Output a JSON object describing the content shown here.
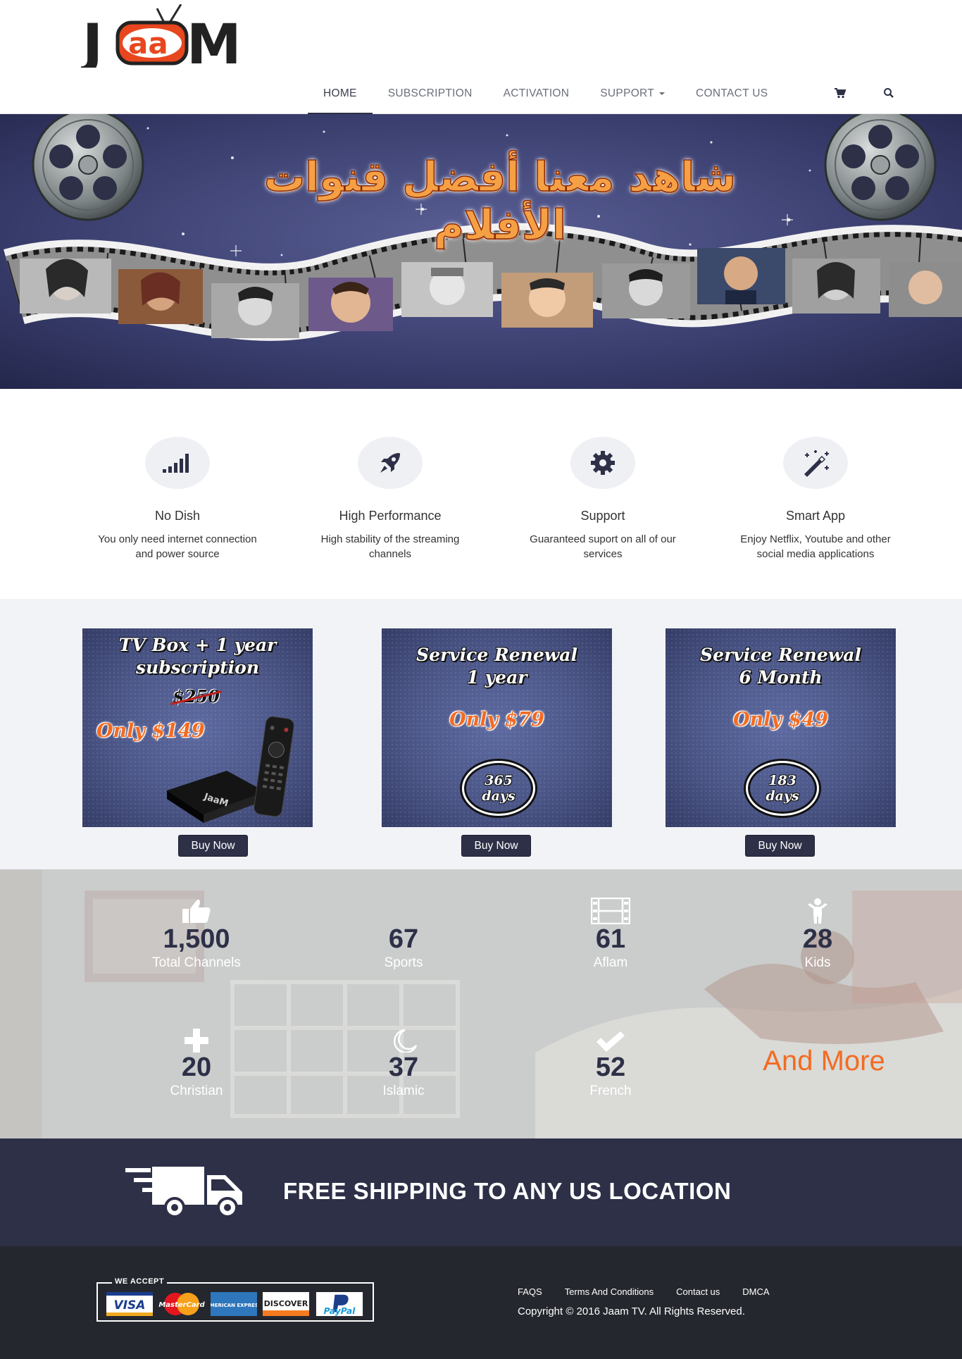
{
  "header": {
    "logo_text": "JaaM",
    "nav": [
      {
        "label": "HOME"
      },
      {
        "label": "SUBSCRIPTION"
      },
      {
        "label": "ACTIVATION"
      },
      {
        "label": "SUPPORT"
      },
      {
        "label": "CONTACT US"
      }
    ],
    "icons": [
      "cart-icon",
      "search-icon"
    ]
  },
  "hero": {
    "title": "شاهد معنا أفضل قنوات الأفلام"
  },
  "features": [
    {
      "icon": "signal-icon",
      "title": "No Dish",
      "desc_line1": "You only need internet connection",
      "desc_line2": "and power source"
    },
    {
      "icon": "rocket-icon",
      "title": "High Performance",
      "desc_line1": "High stability of the streaming",
      "desc_line2": "channels"
    },
    {
      "icon": "gear-icon",
      "title": "Support",
      "desc_line1": "Guaranteed suport on all of our",
      "desc_line2": "services"
    },
    {
      "icon": "magic-wand-icon",
      "title": "Smart App",
      "desc_line1": "Enjoy Netflix, Youtube and other",
      "desc_line2": "social media applications"
    }
  ],
  "packages": [
    {
      "title_line1": "TV Box + 1 year",
      "title_line2": "subscription",
      "old_price": "$250",
      "price": "Only $149",
      "button": "Buy Now"
    },
    {
      "title_line1": "Service Renewal",
      "title_line2": "1 year",
      "price": "Only $79",
      "days_num": "365",
      "days_label": "days",
      "button": "Buy Now"
    },
    {
      "title_line1": "Service Renewal",
      "title_line2": "6 Month",
      "price": "Only $49",
      "days_num": "183",
      "days_label": "days",
      "button": "Buy Now"
    }
  ],
  "stats": [
    {
      "icon": "thumbs-up-icon",
      "number": "1,500",
      "label": "Total Channels"
    },
    {
      "icon": "none",
      "number": "67",
      "label": "Sports"
    },
    {
      "icon": "film-icon",
      "number": "61",
      "label": "Aflam"
    },
    {
      "icon": "child-icon",
      "number": "28",
      "label": "Kids"
    },
    {
      "icon": "plus-icon",
      "number": "20",
      "label": "Christian"
    },
    {
      "icon": "moon-icon",
      "number": "37",
      "label": "Islamic"
    },
    {
      "icon": "check-icon",
      "number": "52",
      "label": "French"
    }
  ],
  "and_more": "And More",
  "shipping": {
    "text": "FREE SHIPPING TO ANY US LOCATION"
  },
  "footer": {
    "we_accept": "WE ACCEPT",
    "cards": [
      "VISA",
      "MasterCard",
      "AMERICAN EXPRESS",
      "DISCOVER",
      "PayPal"
    ],
    "links": [
      "FAQS",
      "Terms And Conditions",
      "Contact us",
      "DMCA"
    ],
    "copyright": "Copyright © 2016 Jaam TV. All Rights Reserved."
  },
  "colors": {
    "navy": "#2d3047",
    "orange": "#f36b21",
    "footer": "#25272e"
  }
}
